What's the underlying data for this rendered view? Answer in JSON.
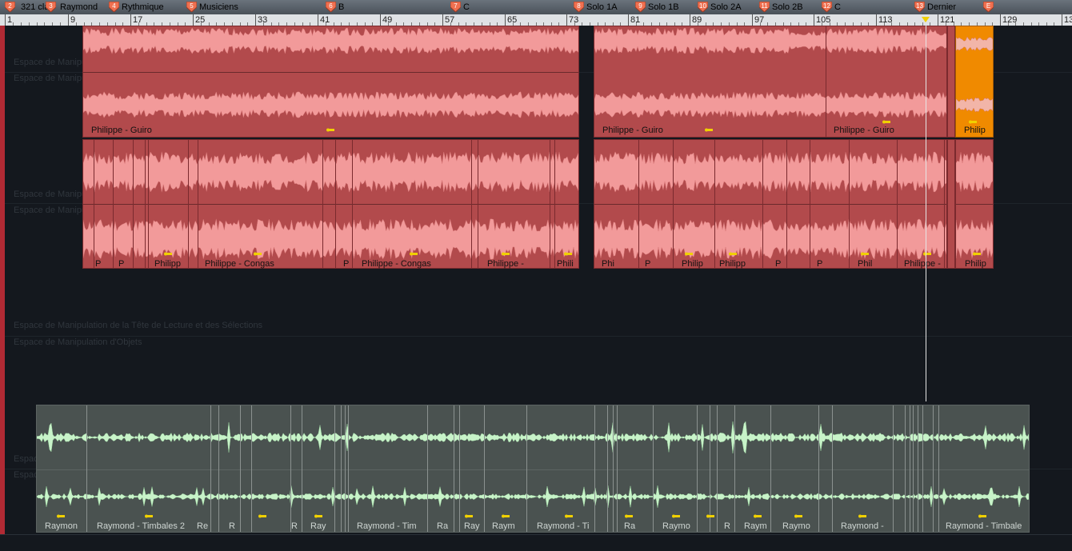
{
  "markers": [
    {
      "num": "2",
      "label": "321 cla"
    },
    {
      "num": "3",
      "label": "Raymond"
    },
    {
      "num": "4",
      "label": "Rythmique"
    },
    {
      "num": "5",
      "label": "Musiciens"
    },
    {
      "num": "6",
      "label": "B"
    },
    {
      "num": "7",
      "label": "C"
    },
    {
      "num": "8",
      "label": "Solo 1A"
    },
    {
      "num": "9",
      "label": "Solo 1B"
    },
    {
      "num": "10",
      "label": "Solo 2A"
    },
    {
      "num": "11",
      "label": "Solo 2B"
    },
    {
      "num": "12",
      "label": "C"
    },
    {
      "num": "13",
      "label": "Dernier"
    },
    {
      "num": "E",
      "label": ""
    }
  ],
  "ruler": [
    "1",
    "9",
    "17",
    "25",
    "33",
    "41",
    "49",
    "57",
    "65",
    "73",
    "81",
    "89",
    "97",
    "105",
    "113",
    "121",
    "129",
    "13"
  ],
  "ghost": {
    "playhead_space": "Espace de Manipulation de la Tête de Lecture et des Sélections",
    "object_space": "Espace de Manipulation d'Objets",
    "short": "Espace de Manipu",
    "tiny": "Espac"
  },
  "tracks": {
    "guiro": {
      "clips": [
        "Philippe - Guiro",
        "Philippe - Guiro",
        "Philippe - Guiro",
        "Philip"
      ]
    },
    "congas": {
      "labels": [
        "P",
        "P",
        "Philipp",
        "Philippe - Congas",
        "P",
        "Philippe - Congas",
        "Philippe -",
        "Phili",
        "Phi",
        "P",
        "Philip",
        "Philipp",
        "P",
        "P",
        "Phil",
        "Philippe -",
        "Philip"
      ]
    },
    "timbales": {
      "labels": [
        "Raymon",
        "Raymond - Timbales 2",
        "Re",
        "R",
        "R",
        "Ray",
        "Raymond - Tim",
        "Ra",
        "Ray",
        "Raym",
        "Raymond - Ti",
        "Ra",
        "Raymo",
        "R",
        "Raym",
        "Raymo",
        "Raymond -",
        "Raymond - Timbale"
      ]
    }
  },
  "colors": {
    "clip_red": "#b24a4c",
    "clip_orange": "#f08a00",
    "clip_green": "#4a5250",
    "wave_red": "#f29a9a",
    "wave_green": "#c8f3c9"
  }
}
